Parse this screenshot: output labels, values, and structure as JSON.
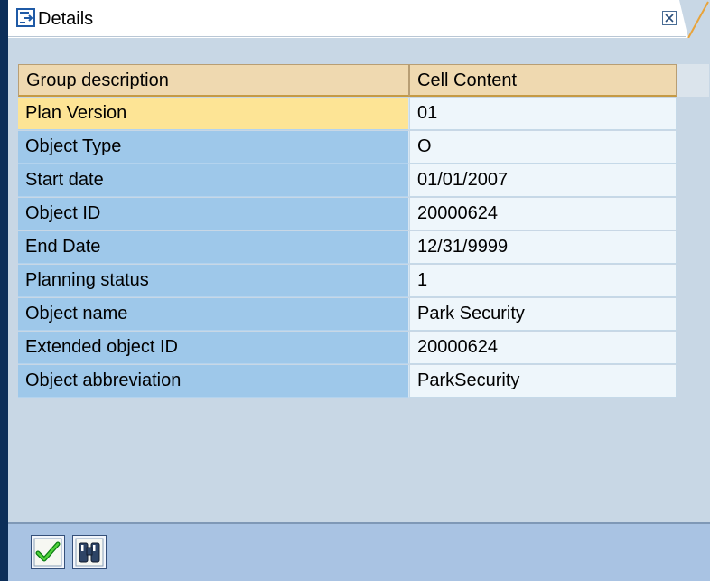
{
  "window": {
    "title": "Details",
    "icons": {
      "title": "details-icon",
      "close": "close-icon"
    }
  },
  "table": {
    "headers": [
      "Group description",
      "Cell Content"
    ],
    "rows": [
      [
        "Plan Version",
        "01"
      ],
      [
        "Object Type",
        "O"
      ],
      [
        "Start date",
        "01/01/2007"
      ],
      [
        "Object ID",
        "20000624"
      ],
      [
        "End Date",
        "12/31/9999"
      ],
      [
        "Planning status",
        "1"
      ],
      [
        "Object name",
        "Park Security"
      ],
      [
        "Extended object ID",
        "20000624"
      ],
      [
        "Object abbreviation",
        "ParkSecurity"
      ]
    ],
    "selected_row": 0
  },
  "footer": {
    "buttons": [
      {
        "name": "continue",
        "icon": "green-checkmark-icon"
      },
      {
        "name": "find",
        "icon": "binoculars-icon"
      }
    ]
  },
  "colors": {
    "frame": "#0c2e59",
    "content_bg": "#c8d7e5",
    "header_bg": "#efd9b0",
    "label_cell_bg": "#9ec8ea",
    "selected_cell_bg": "#fde495",
    "value_cell_bg": "#eef6fb",
    "footer_bg": "#a9c3e3"
  }
}
